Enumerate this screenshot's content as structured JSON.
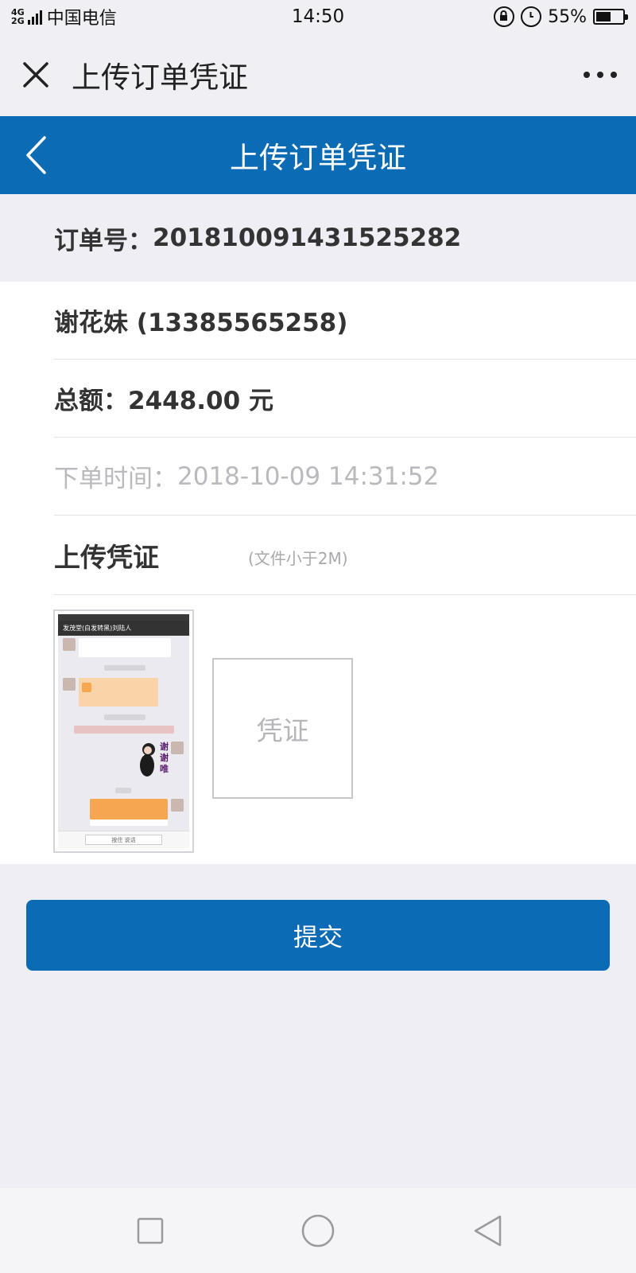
{
  "status_bar": {
    "network_top": "4G",
    "network_bottom": "2G",
    "carrier": "中国电信",
    "time": "14:50",
    "battery_percent": "55%",
    "battery_level": 0.55,
    "icons": [
      "signal-icon",
      "lock-rotation-icon",
      "alarm-icon",
      "battery-icon"
    ]
  },
  "wechat_bar": {
    "title": "上传订单凭证",
    "close_icon": "close-icon",
    "more_icon": "more-dots-icon"
  },
  "header": {
    "title": "上传订单凭证",
    "back_icon": "chevron-left-icon",
    "color": "#0b6cb5"
  },
  "order": {
    "order_no_label": "订单号：",
    "order_no": "201810091431525282",
    "customer": "谢花妹 (13385565258)",
    "total_label": "总额：",
    "total": "2448.00 元",
    "time_label": "下单时间：",
    "time": "2018-10-09 14:31:52"
  },
  "upload": {
    "title": "上传凭证",
    "hint": "(文件小于2M)",
    "add_box_label": "凭证",
    "thumbnail": {
      "chat_title": "发茂堂(白发转黑)刘陆人",
      "sticker_text": "谢谢唯",
      "input_label": "按住 说话"
    }
  },
  "actions": {
    "submit_label": "提交"
  },
  "navbar": {
    "icons": [
      "square-recent-icon",
      "circle-home-icon",
      "triangle-back-icon"
    ]
  }
}
